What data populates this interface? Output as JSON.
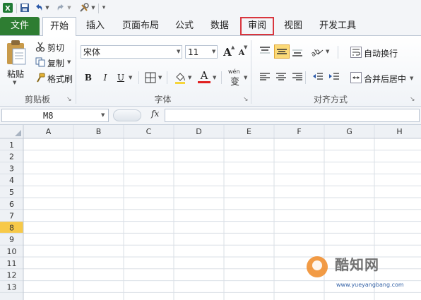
{
  "ribbon_tabs": [
    {
      "label": "文件"
    },
    {
      "label": "开始"
    },
    {
      "label": "插入"
    },
    {
      "label": "页面布局"
    },
    {
      "label": "公式"
    },
    {
      "label": "数据"
    },
    {
      "label": "审阅"
    },
    {
      "label": "视图"
    },
    {
      "label": "开发工具"
    }
  ],
  "active_tab": "开始",
  "highlighted_tab": "审阅",
  "clipboard": {
    "paste_label": "粘贴",
    "cut_label": "剪切",
    "copy_label": "复制",
    "format_painter_label": "格式刷",
    "group_label": "剪贴板"
  },
  "font": {
    "name": "宋体",
    "size": "11",
    "bold_label": "B",
    "italic_label": "I",
    "underline_label": "U",
    "grow_label": "A",
    "shrink_label": "A",
    "color_label": "A",
    "phonetic_label": "wén",
    "phonetic_char": "变",
    "group_label": "字体"
  },
  "alignment": {
    "wrap_label": "自动换行",
    "merge_label": "合并后居中",
    "group_label": "对齐方式"
  },
  "formula_bar": {
    "name_box": "M8",
    "fx_label": "fx",
    "content": ""
  },
  "sheet": {
    "columns": [
      "A",
      "B",
      "C",
      "D",
      "E",
      "F",
      "G",
      "H"
    ],
    "rows": [
      "1",
      "2",
      "3",
      "4",
      "5",
      "6",
      "7",
      "8",
      "9",
      "10",
      "11",
      "12",
      "13"
    ],
    "selected_row": "8"
  },
  "watermark": {
    "brand": "酷知网",
    "site": "www.yueyangbang.com"
  },
  "colors": {
    "file_tab": "#2e7d32",
    "highlight_box": "#d9363e",
    "selected_header": "#f7c948",
    "font_color_bar": "#e02020"
  }
}
